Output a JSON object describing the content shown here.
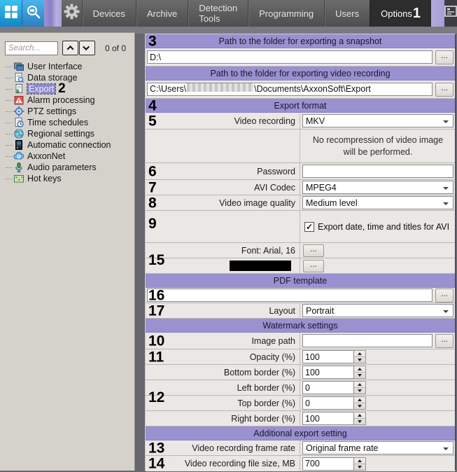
{
  "topbar": {
    "menu": [
      "Devices",
      "Archive",
      "Detection Tools",
      "Programming",
      "Users",
      "Options"
    ],
    "active_menu": "Options"
  },
  "sidebar": {
    "search_placeholder": "Search...",
    "match_count": "0 of 0",
    "items": [
      {
        "label": "User Interface",
        "icon": "window-icon"
      },
      {
        "label": "Data storage",
        "icon": "storage-search-icon"
      },
      {
        "label": "Export",
        "icon": "export-document-icon",
        "selected": true
      },
      {
        "label": "Alarm processing",
        "icon": "alarm-icon"
      },
      {
        "label": "PTZ settings",
        "icon": "crosshair-icon"
      },
      {
        "label": "Time schedules",
        "icon": "clock-icon"
      },
      {
        "label": "Regional settings",
        "icon": "globe-icon"
      },
      {
        "label": "Automatic connection",
        "icon": "server-icon"
      },
      {
        "label": "AxxonNet",
        "icon": "cloud-icon"
      },
      {
        "label": "Audio parameters",
        "icon": "microphone-icon"
      },
      {
        "label": "Hot keys",
        "icon": "keyboard-icon"
      }
    ]
  },
  "panel": {
    "snapshot_header": "Path to the folder for exporting a snapshot",
    "snapshot_path": "D:\\",
    "video_header": "Path to the folder for exporting video recording",
    "video_path_prefix": "C:\\Users\\",
    "video_path_suffix": "\\Documents\\AxxonSoft\\Export",
    "browse_label": "...",
    "export_format_header": "Export format",
    "video_recording_label": "Video recording",
    "video_recording_value": "MKV",
    "note_text": "No recompression of video image will be performed.",
    "password_label": "Password",
    "avi_codec_label": "AVI Codec",
    "avi_codec_value": "MPEG4",
    "quality_label": "Video image quality",
    "quality_value": "Medium level",
    "titles_checkbox_label": "Export date, time and titles for AVI",
    "checkbox_checked": "✓",
    "font_label": "Font: Arial, 16",
    "pdf_header": "PDF template",
    "layout_label": "Layout",
    "layout_value": "Portrait",
    "watermark_header": "Watermark settings",
    "image_path_label": "Image path",
    "opacity_label": "Opacity (%)",
    "opacity_value": "100",
    "bottom_border_label": "Bottom border (%)",
    "bottom_border_value": "100",
    "left_border_label": "Left border (%)",
    "left_border_value": "0",
    "top_border_label": "Top border (%)",
    "top_border_value": "0",
    "right_border_label": "Right border (%)",
    "right_border_value": "100",
    "additional_header": "Additional export setting",
    "framerate_label": "Video recording frame rate",
    "framerate_value": "Original frame rate",
    "filesize_label": "Video recording file size, MB",
    "filesize_value": "700"
  },
  "annotations": {
    "n1": "1",
    "n2": "2",
    "n3": "3",
    "n4": "4",
    "n5": "5",
    "n6": "6",
    "n7": "7",
    "n8": "8",
    "n9": "9",
    "n10": "10",
    "n11": "11",
    "n12": "12",
    "n13": "13",
    "n14": "14",
    "n15": "15",
    "n16": "16",
    "n17": "17"
  }
}
